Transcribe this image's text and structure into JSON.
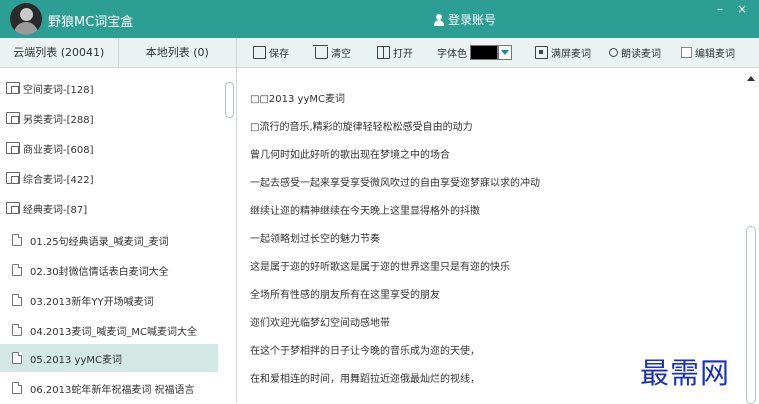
{
  "app": {
    "title": "野狼MC词宝盒",
    "login_label": "登录账号",
    "min_label": "–",
    "close_label": "×"
  },
  "tabs": {
    "cloud": "云端列表 (20041)",
    "local": "本地列表 (0)"
  },
  "sidebar": {
    "categories": [
      {
        "label": "空间麦词-[128]",
        "icon": "folder-icon"
      },
      {
        "label": "另类麦词-[288]",
        "icon": "folder-icon"
      },
      {
        "label": "商业麦词-[608]",
        "icon": "folder-icon"
      },
      {
        "label": "综合麦词-[422]",
        "icon": "folder-icon"
      },
      {
        "label": "经典麦词-[87]",
        "icon": "folder-icon"
      }
    ],
    "files": [
      {
        "label": "01.25句经典语录_喊麦词_麦词"
      },
      {
        "label": "02.30封微信情话表白麦词大全"
      },
      {
        "label": "03.2013新年YY开场喊麦词"
      },
      {
        "label": "04.2013麦词_喊麦词_MC喊麦词大全"
      },
      {
        "label": "05.2013  yyMC麦词",
        "selected": true
      },
      {
        "label": "06.2013蛇年新年祝福麦词 祝福语言"
      }
    ]
  },
  "toolbar": {
    "save": "保存",
    "clear": "清空",
    "open": "打开",
    "font_color_label": "字体色",
    "font_color": "#000000",
    "fullscreen": "满屏麦词",
    "read": "朗读麦词",
    "edit": "编辑麦词"
  },
  "content": {
    "lines": [
      "□□2013 yyMC麦词",
      "□流行的音乐,精彩的旋律轻轻松松感受自由的动力",
      "曾几何时如此好听的歌出现在梦境之中的场合",
      "一起去感受一起来享受享受微风吹过的自由享受迩梦寐以求的冲动",
      "继续让迩的精神继续在今天晚上这里显得格外的抖擞",
      "一起领略划过长空的魅力节奏",
      "这是属于迩的好听歌这是属于迩的世界这里只是有迩的快乐",
      "全场所有性感的朋友所有在这里享受的朋友",
      "迩们欢迎光临梦幻空间动感地带",
      "在这个于梦相拌的日子让今晚的音乐成为迩的天使，",
      "在和爱相连的时间，用舞蹈拉近迩俄最灿烂的视线，"
    ]
  },
  "watermark": "最需网",
  "colors": {
    "titlebar": "#2d9e93",
    "panel": "#eaf3f2",
    "selected": "#d3e8e5"
  }
}
